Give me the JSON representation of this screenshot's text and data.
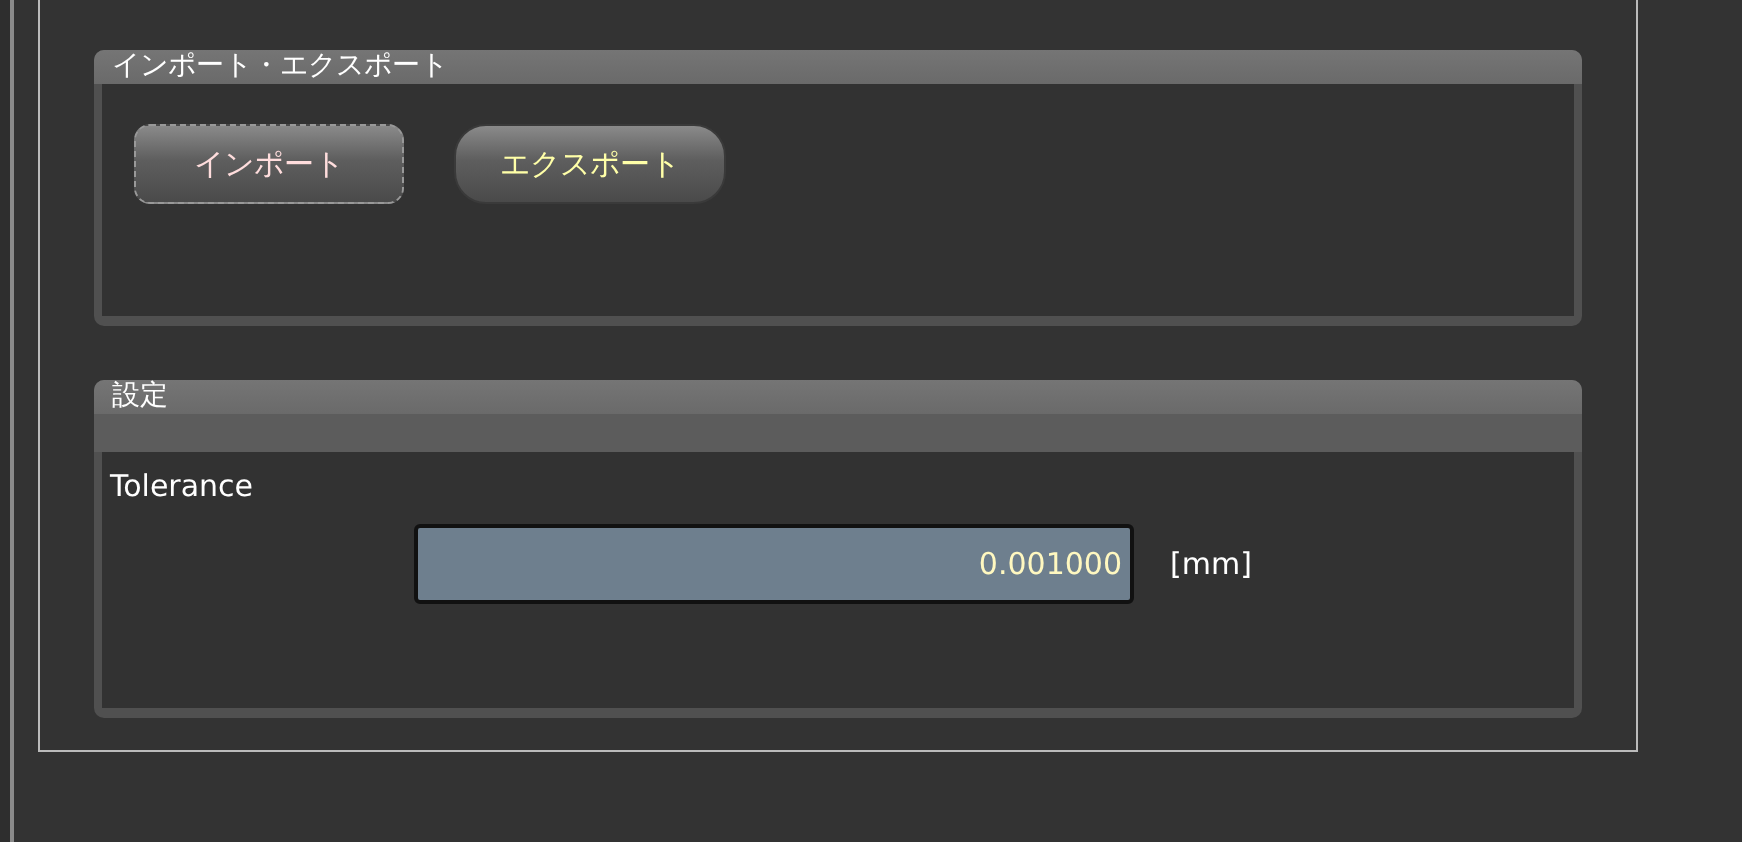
{
  "groups": [
    {
      "kind": "buttons",
      "title": "インポート・エクスポート",
      "buttons": [
        {
          "label": "インポート",
          "focused": true
        },
        {
          "label": "エクスポート",
          "focused": false
        }
      ]
    },
    {
      "kind": "settings",
      "title": "設定",
      "label": "Tolerance",
      "value": "0.001000",
      "unit": "[mm]"
    }
  ]
}
